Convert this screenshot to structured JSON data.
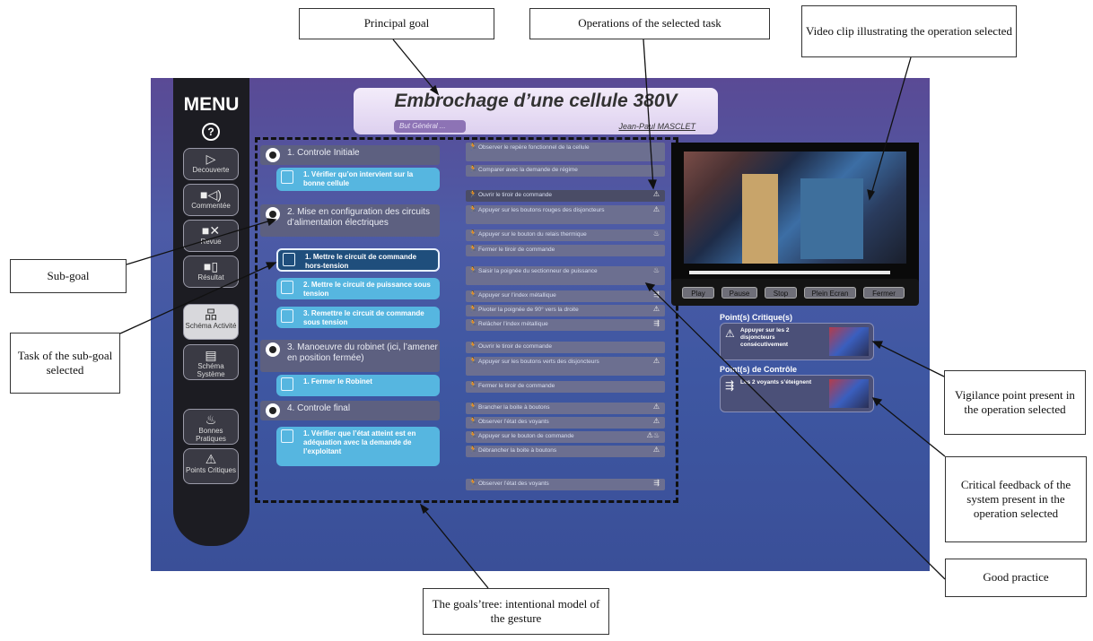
{
  "annotations": {
    "principal_goal": "Principal goal",
    "operations": "Operations of the selected task",
    "video": "Video clip illustrating the operation selected",
    "sub_goal": "Sub-goal",
    "task": "Task of the sub-goal selected",
    "vigilance": "Vigilance point present in the operation selected",
    "critical_feedback": "Critical feedback of the system present in the operation selected",
    "good_practice": "Good practice",
    "goals_tree": "The goals’tree: intentional model of the gesture"
  },
  "app": {
    "menu": {
      "title": "MENU",
      "help": "?",
      "items": [
        {
          "label": "Decouverte",
          "icon": "play-icon"
        },
        {
          "label": "Commentée",
          "icon": "camera-sound-icon"
        },
        {
          "label": "Revue",
          "icon": "camera-cross-icon"
        },
        {
          "label": "Résultat",
          "icon": "camera-flag-icon"
        },
        {
          "label": "Schéma Activité",
          "icon": "hierarchy-icon"
        },
        {
          "label": "Schéma Système",
          "icon": "system-diagram-icon"
        },
        {
          "label": "Bonnes Pratiques",
          "icon": "good-practice-icon"
        },
        {
          "label": "Points Critiques",
          "icon": "warning-icon"
        }
      ]
    },
    "title": "Embrochage d’une cellule 380V",
    "general_goal_tag": "But Général ...",
    "author": "Jean-Paul MASCLET",
    "goals": [
      {
        "label": "1. Controle Initiale"
      },
      {
        "label": "2. Mise en configuration des circuits d’alimentation électriques"
      },
      {
        "label": "3. Manoeuvre du robinet (ici, l’amener en position fermée)"
      },
      {
        "label": "4. Controle final"
      }
    ],
    "tasks": [
      {
        "label": "1. Vérifier qu’on intervient sur la bonne cellule"
      },
      {
        "label": "1. Mettre le circuit de commande hors-tension"
      },
      {
        "label": "2. Mettre le circuit de puissance sous tension"
      },
      {
        "label": "3. Remettre le circuit de commande sous tension"
      },
      {
        "label": "1. Fermer le Robinet"
      },
      {
        "label": "1. Vérifier que l’état atteint est en adéquation avec la demande de l’exploitant"
      }
    ],
    "operations": [
      {
        "label": "Observer le repère fonctionnel de la cellule"
      },
      {
        "label": "Comparer avec la demande de régime"
      },
      {
        "label": "Ouvrir le tiroir de commande"
      },
      {
        "label": "Appuyer sur les boutons rouges des disjoncteurs"
      },
      {
        "label": "Appuyer sur le bouton du relais thermique"
      },
      {
        "label": "Fermer le tiroir de commande"
      },
      {
        "label": "Saisir la poignée du sectionneur de puissance"
      },
      {
        "label": "Appuyer sur l’index métallique"
      },
      {
        "label": "Pivoter la poignée de 90° vers la droite"
      },
      {
        "label": "Relâcher l’index métallique"
      },
      {
        "label": "Ouvrir le tiroir de commande"
      },
      {
        "label": "Appuyer sur les boutons verts des disjoncteurs"
      },
      {
        "label": "Fermer le tiroir de commande"
      },
      {
        "label": "Brancher la boite à boutons"
      },
      {
        "label": "Observer l’état des voyants"
      },
      {
        "label": "Appuyer sur le bouton de commande"
      },
      {
        "label": "Débrancher la boite à boutons"
      },
      {
        "label": "Observer l’état des voyants"
      }
    ],
    "video_controls": [
      "Play",
      "Pause",
      "Stop",
      "Plein Ecran",
      "Fermer"
    ],
    "critical_points": {
      "label": "Point(s) Critique(s)",
      "item": "Appuyer sur les 2 disjoncteurs consécutivement"
    },
    "control_points": {
      "label": "Point(s) de Contrôle",
      "item": "Les 2 voyants s’éteignent"
    }
  }
}
